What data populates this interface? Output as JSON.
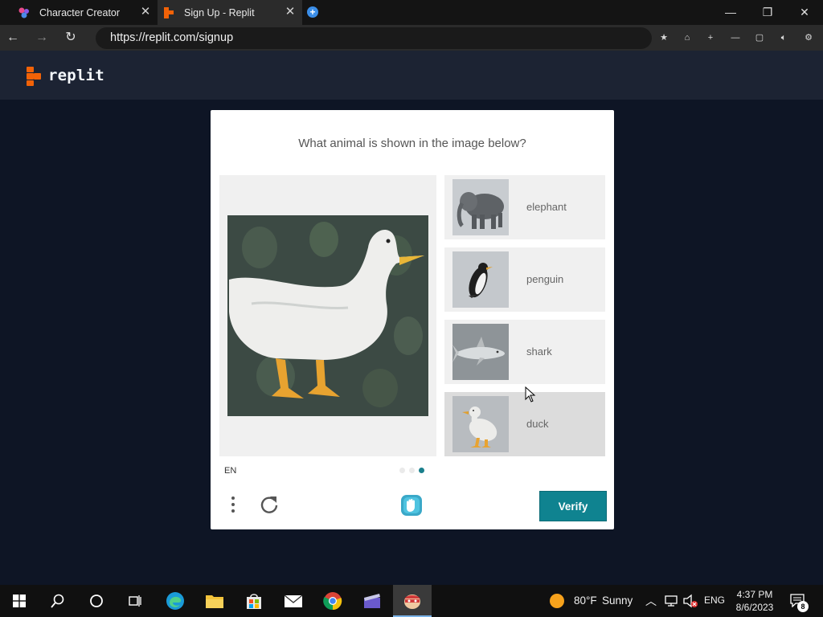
{
  "browser": {
    "tabs": [
      {
        "title": "Character Creator"
      },
      {
        "title": "Sign Up - Replit"
      }
    ],
    "address": "https://replit.com/signup"
  },
  "header": {
    "brand": "replit"
  },
  "captcha": {
    "question": "What animal is shown in the image below?",
    "options": [
      {
        "label": "elephant"
      },
      {
        "label": "penguin"
      },
      {
        "label": "shark"
      },
      {
        "label": "duck"
      }
    ],
    "language": "EN",
    "verify_label": "Verify",
    "page_count": 3,
    "active_page": 3
  },
  "taskbar": {
    "weather_temp": "80°F",
    "weather_cond": "Sunny",
    "lang": "ENG",
    "time": "4:37 PM",
    "date": "8/6/2023",
    "notification_count": "8"
  },
  "colors": {
    "replit_bg": "#0e1525",
    "replit_header": "#1c2333",
    "verify_button": "#0f8390",
    "accent_orange": "#f26207"
  }
}
